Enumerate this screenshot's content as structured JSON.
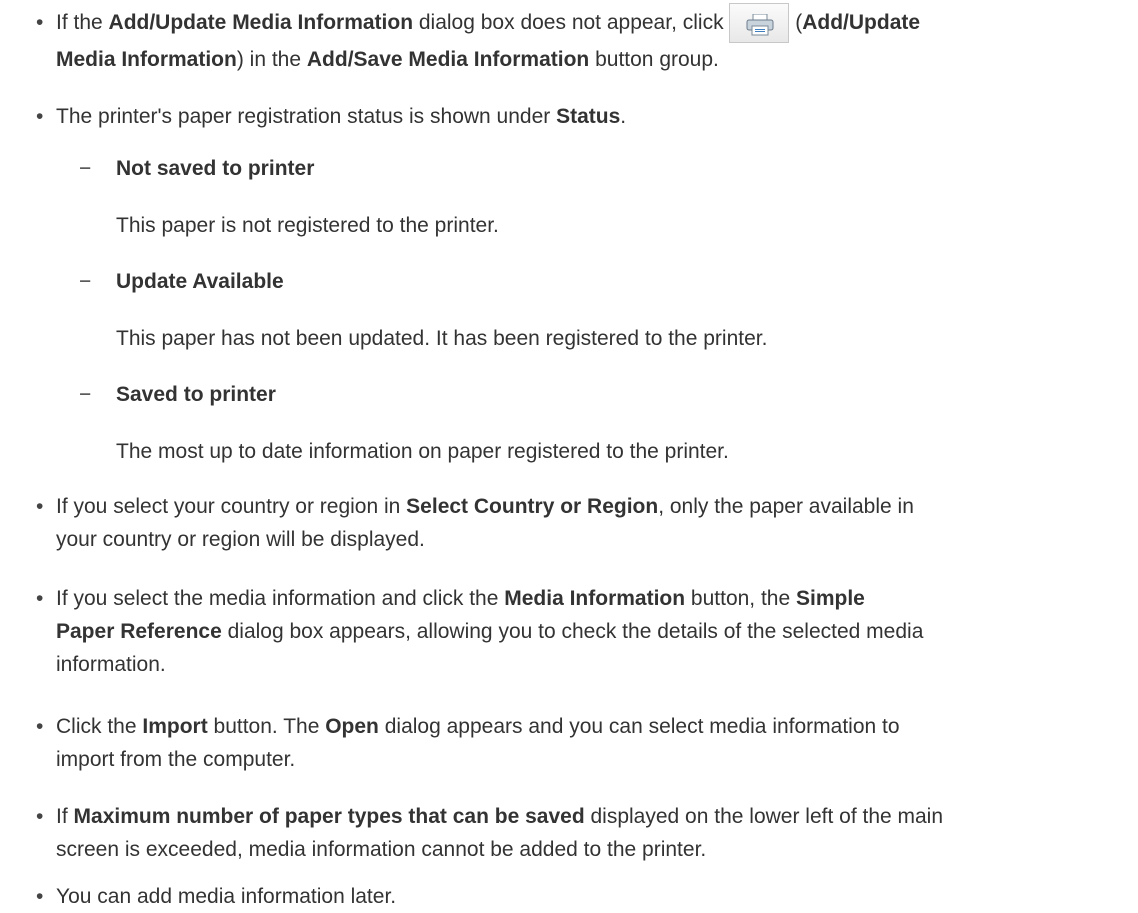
{
  "bullets": [
    {
      "t1": "If the ",
      "b1": "Add/Update Media Information",
      "t2": " dialog box does not appear, click ",
      "t3": " (",
      "b2": "Add/Update",
      "b3": "Media Information",
      "t4": ") in the ",
      "b4": "Add/Save Media Information",
      "t5": " button group."
    },
    {
      "t1": "The printer's paper registration status is shown under ",
      "b1": "Status",
      "t2": "."
    },
    {
      "t1": "If you select your country or region in ",
      "b1": "Select Country or Region",
      "t2": ", only the paper available in",
      "t3": "your country or region will be displayed."
    },
    {
      "t1": "If you select the media information and click the ",
      "b1": "Media Information",
      "t2": " button, the ",
      "b2": "Simple",
      "b3": "Paper Reference",
      "t3": " dialog box appears, allowing you to check the details of the selected media",
      "t4": "information."
    },
    {
      "t1": "Click the ",
      "b1": "Import",
      "t2": " button. The ",
      "b2": "Open",
      "t3": " dialog appears and you can select media information to",
      "t4": "import from the computer."
    },
    {
      "t1": "If ",
      "b1": "Maximum number of paper types that can be saved",
      "t2": " displayed on the lower left of the main",
      "t3": "screen is exceeded, media information cannot be added to the printer."
    },
    {
      "t1": "You can add media information later."
    }
  ],
  "statuses": [
    {
      "label": "Not saved to printer",
      "desc": "This paper is not registered to the printer."
    },
    {
      "label": "Update Available",
      "desc": "This paper has not been updated. It has been registered to the printer."
    },
    {
      "label": "Saved to printer",
      "desc": "The most up to date information on paper registered to the printer."
    }
  ],
  "glyphs": {
    "bullet": "•",
    "dash": "−"
  },
  "icons": {
    "add_update_button": "printer-icon"
  }
}
